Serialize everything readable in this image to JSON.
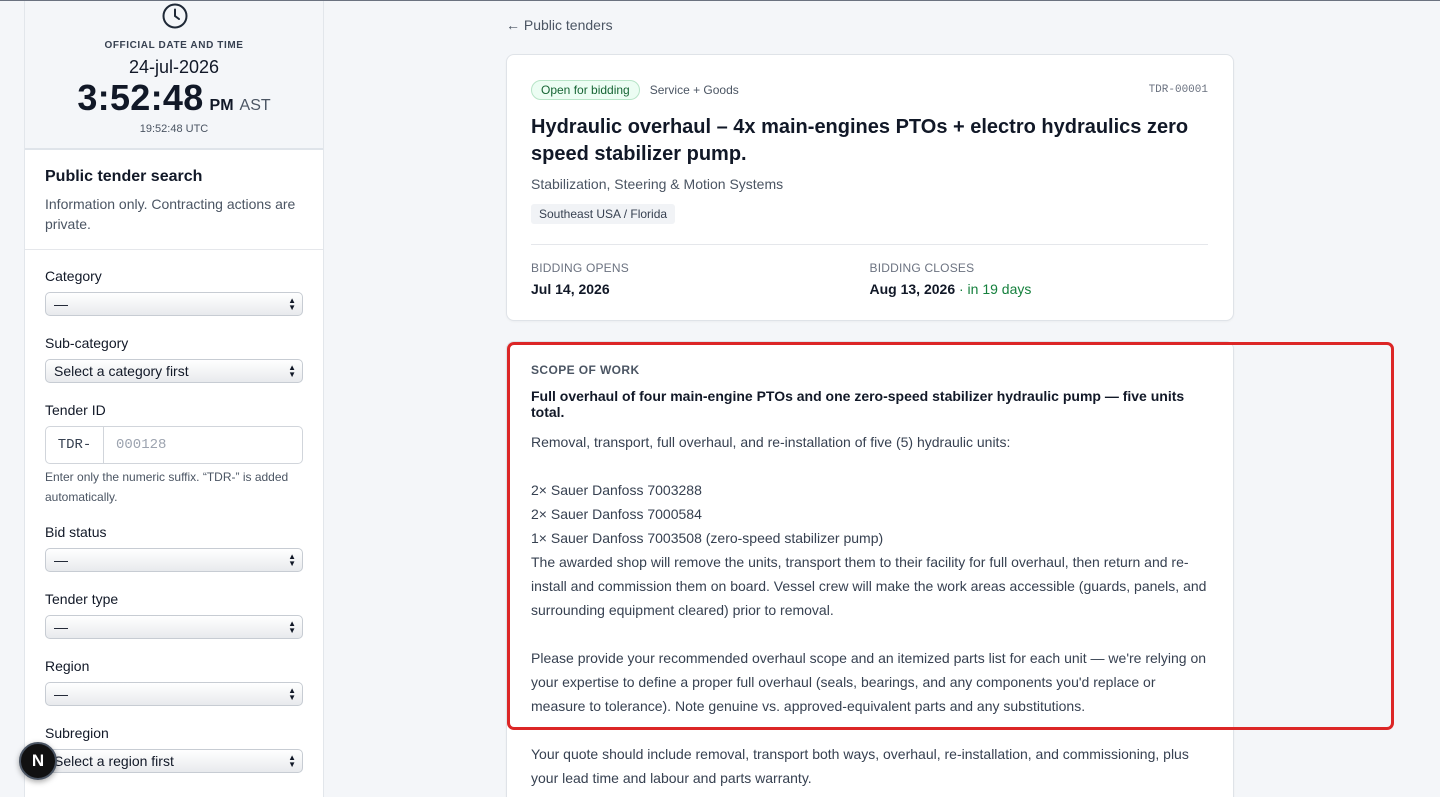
{
  "clock": {
    "label": "OFFICIAL DATE AND TIME",
    "date": "24-jul-2026",
    "time": "3:52:48",
    "ampm": "PM",
    "tz": "AST",
    "utc": "19:52:48 UTC"
  },
  "search": {
    "title": "Public tender search",
    "description": "Information only. Contracting actions are private."
  },
  "filters": {
    "category": {
      "label": "Category",
      "value": "—"
    },
    "subcategory": {
      "label": "Sub-category",
      "value": "Select a category first"
    },
    "tender_id": {
      "label": "Tender ID",
      "prefix": "TDR-",
      "placeholder": "000128",
      "hint": "Enter only the numeric suffix. “TDR-” is added automatically."
    },
    "bid_status": {
      "label": "Bid status",
      "value": "—"
    },
    "tender_type": {
      "label": "Tender type",
      "value": "—"
    },
    "region": {
      "label": "Region",
      "value": "—"
    },
    "subregion": {
      "label": "Subregion",
      "value": "Select a region first"
    }
  },
  "badge": {
    "letter": "N"
  },
  "nav": {
    "back": "← Public tenders"
  },
  "tender": {
    "status": "Open for bidding",
    "type": "Service + Goods",
    "code": "TDR-00001",
    "title": "Hydraulic overhaul – 4x main-engines PTOs + electro hydraulics zero speed stabilizer pump.",
    "category": "Stabilization, Steering & Motion Systems",
    "region": "Southeast USA / Florida",
    "opens_label": "BIDDING OPENS",
    "opens_value": "Jul 14, 2026",
    "closes_label": "BIDDING CLOSES",
    "closes_value": "Aug 13, 2026",
    "closes_relative": " · in 19 days"
  },
  "scope": {
    "label": "SCOPE OF WORK",
    "lead": "Full overhaul of four main-engine PTOs and one zero-speed stabilizer hydraulic pump — five units total.",
    "intro": "Removal, transport, full overhaul, and re-installation of five (5) hydraulic units:",
    "units": [
      "2× Sauer Danfoss 7003288",
      "2× Sauer Danfoss 7000584",
      "1× Sauer Danfoss 7003508 (zero-speed stabilizer pump)"
    ],
    "para1": "The awarded shop will remove the units, transport them to their facility for full overhaul, then return and re-install and commission them on board. Vessel crew will make the work areas accessible (guards, panels, and surrounding equipment cleared) prior to removal.",
    "para2": "Please provide your recommended overhaul scope and an itemized parts list for each unit — we're relying on your expertise to define a proper full overhaul (seals, bearings, and any components you'd replace or measure to tolerance). Note genuine vs. approved-equivalent parts and any substitutions.",
    "para3": "Your quote should include removal, transport both ways, overhaul, re-installation, and commissioning, plus your lead time and labour and parts warranty."
  },
  "colors": {
    "highlight": "#dc2626",
    "status_green": "#166534",
    "relative_green": "#15803d"
  }
}
